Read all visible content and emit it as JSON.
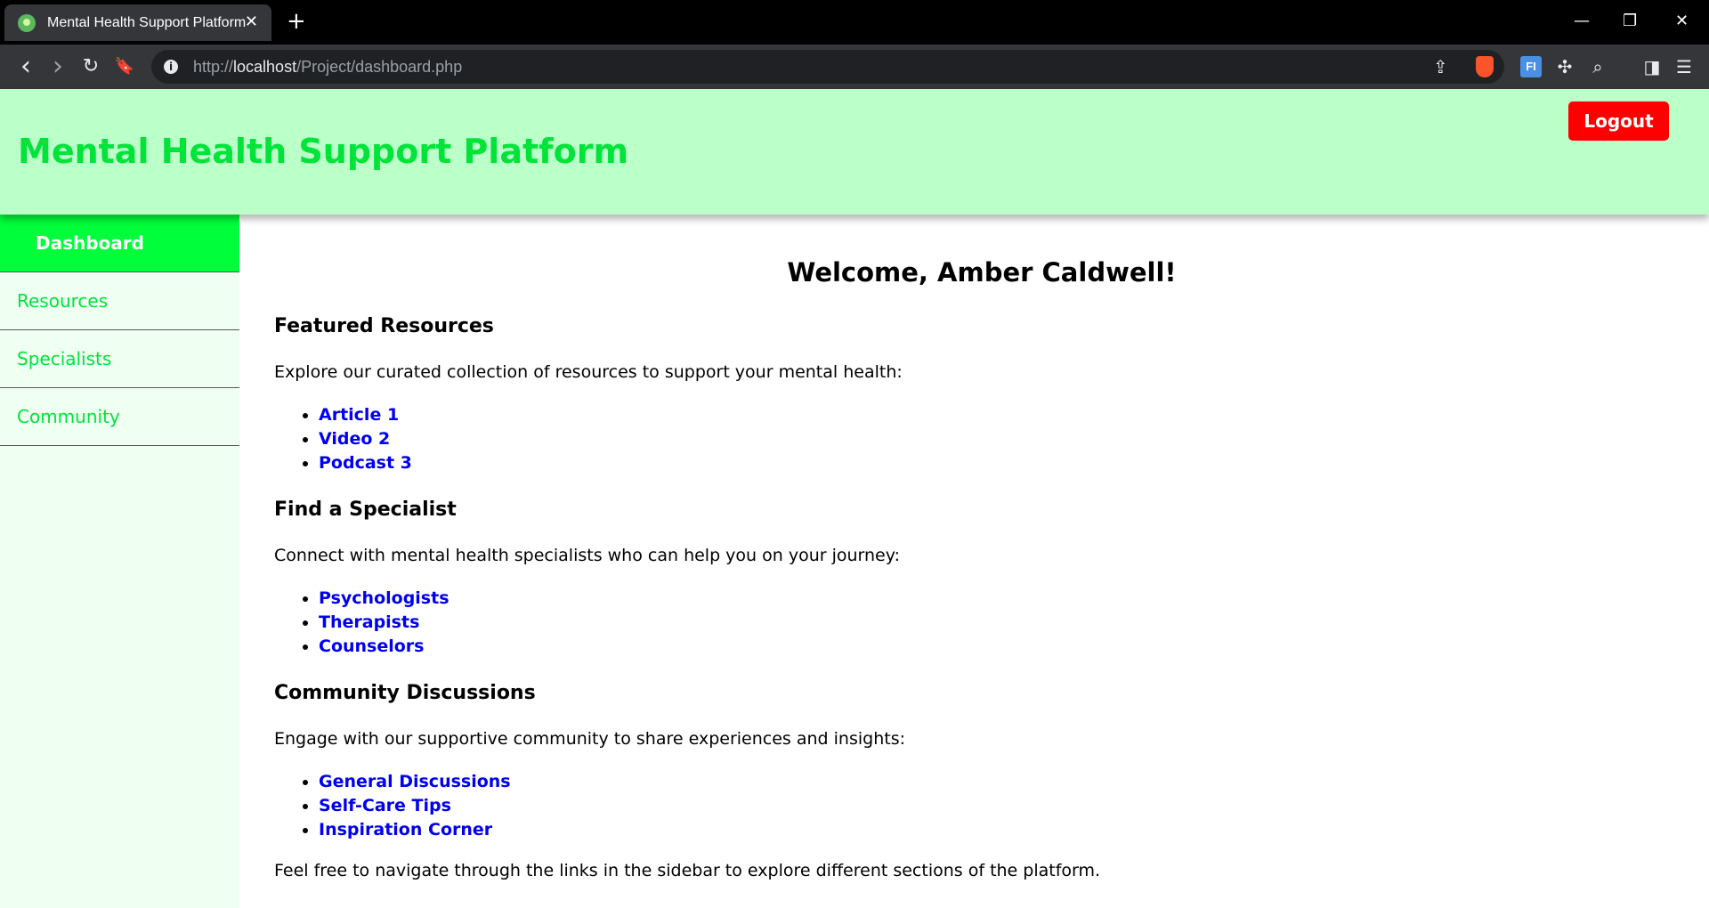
{
  "browser": {
    "tab_title": "Mental Health Support Platform",
    "tab_close": "✕",
    "new_tab": "+",
    "url_prefix": "http://",
    "url_host": "localhost",
    "url_path": "/Project/dashboard.php",
    "window_controls": {
      "minimize": "—",
      "restore": "❐",
      "close": "✕"
    },
    "nav": {
      "back": "‹",
      "forward": "›",
      "reload": "↻",
      "bookmark": "🔖"
    }
  },
  "header": {
    "title": "Mental Health Support Platform",
    "logout_label": "Logout",
    "background": "#bbffc9",
    "title_color": "#00e43a",
    "logout_color": "#ff0000"
  },
  "sidebar": {
    "items": [
      {
        "label": "Dashboard",
        "active": true
      },
      {
        "label": "Resources",
        "active": false
      },
      {
        "label": "Specialists",
        "active": false
      },
      {
        "label": "Community",
        "active": false
      }
    ],
    "active_color": "#00ff3a",
    "text_color": "#00e43a"
  },
  "main": {
    "welcome": "Welcome, Amber Caldwell!",
    "sections": [
      {
        "title": "Featured Resources",
        "description": "Explore our curated collection of resources to support your mental health:",
        "links": [
          "Article 1",
          "Video 2",
          "Podcast 3"
        ]
      },
      {
        "title": "Find a Specialist",
        "description": "Connect with mental health specialists who can help you on your journey:",
        "links": [
          "Psychologists",
          "Therapists",
          "Counselors"
        ]
      },
      {
        "title": "Community Discussions",
        "description": "Engage with our supportive community to share experiences and insights:",
        "links": [
          "General Discussions",
          "Self-Care Tips",
          "Inspiration Corner"
        ]
      }
    ],
    "footer_note": "Feel free to navigate through the links in the sidebar to explore different sections of the platform.",
    "link_color": "#0000ee"
  }
}
